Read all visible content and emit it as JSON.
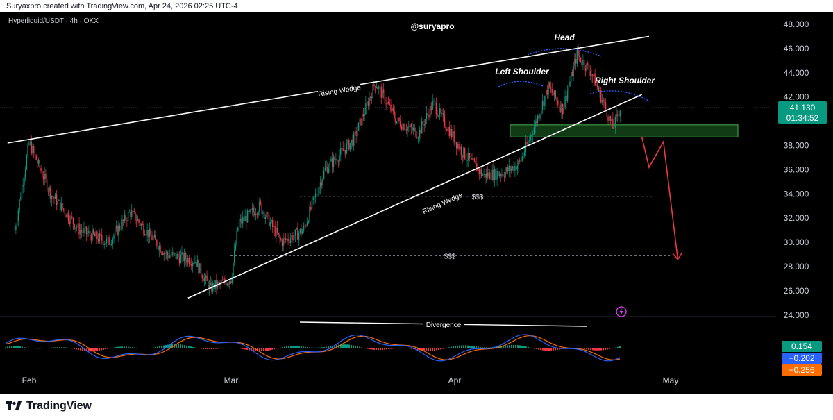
{
  "header": {
    "created_by": "Suryaxpro created with TradingView.com, Apr 24, 2026 02:25 UTC-4"
  },
  "symbol": {
    "label": "Hyperliquid/USDT · 4h · OKX"
  },
  "watermark": "@suryapro",
  "annotations": {
    "head": "Head",
    "left_shoulder": "Left Shoulder",
    "right_shoulder": "Right Shoulder",
    "rising_wedge_upper": "Rising Wedge",
    "rising_wedge_lower": "Rising Wedge",
    "liquidity_1": "$$$",
    "liquidity_2": "$$$",
    "divergence": "Divergence"
  },
  "price_tag": {
    "price": "41.130",
    "countdown": "01:34:52",
    "color": "#089981"
  },
  "indicator_tags": [
    {
      "value": "0.154",
      "color": "#089981"
    },
    {
      "value": "−0.202",
      "color": "#2962ff"
    },
    {
      "value": "−0.256",
      "color": "#ff6d00"
    }
  ],
  "footer": {
    "brand": "TradingView"
  },
  "colors": {
    "candle_up": "#089981",
    "candle_down": "#f23645",
    "wedge_line": "#ffffff",
    "support_zone": "#1e6b24",
    "projection": "#f23645",
    "shoulder_arc": "#2962ff",
    "fast_line": "#2962ff",
    "slow_line": "#ff6d00"
  },
  "chart_data": {
    "type": "candlestick",
    "title": "Hyperliquid/USDT · 4h · OKX",
    "y_axis": {
      "ticks": [
        "48.000",
        "46.000",
        "44.000",
        "42.000",
        "40.000",
        "38.000",
        "36.000",
        "34.000",
        "32.000",
        "30.000",
        "28.000",
        "26.000",
        "24.000"
      ],
      "range": [
        24,
        48
      ]
    },
    "x_axis": {
      "ticks": [
        "Feb",
        "Mar",
        "Apr",
        "May"
      ]
    },
    "price_path": [
      {
        "date": "Jan 30",
        "price": 31
      },
      {
        "date": "Feb 1",
        "price": 38.2
      },
      {
        "date": "Feb 4",
        "price": 34
      },
      {
        "date": "Feb 8",
        "price": 31
      },
      {
        "date": "Feb 12",
        "price": 30
      },
      {
        "date": "Feb 15",
        "price": 32.5
      },
      {
        "date": "Feb 20",
        "price": 29
      },
      {
        "date": "Feb 24",
        "price": 28.5
      },
      {
        "date": "Feb 26",
        "price": 26.2
      },
      {
        "date": "Mar 1",
        "price": 27
      },
      {
        "date": "Mar 2",
        "price": 31.5
      },
      {
        "date": "Mar 5",
        "price": 33
      },
      {
        "date": "Mar 8",
        "price": 30
      },
      {
        "date": "Mar 11",
        "price": 31
      },
      {
        "date": "Mar 14",
        "price": 36
      },
      {
        "date": "Mar 18",
        "price": 38.5
      },
      {
        "date": "Mar 21",
        "price": 43.2
      },
      {
        "date": "Mar 24",
        "price": 40
      },
      {
        "date": "Mar 27",
        "price": 39
      },
      {
        "date": "Mar 29",
        "price": 41.5
      },
      {
        "date": "Apr 2",
        "price": 37.5
      },
      {
        "date": "Apr 5",
        "price": 35.5
      },
      {
        "date": "Apr 8",
        "price": 35.8
      },
      {
        "date": "Apr 10",
        "price": 36.5
      },
      {
        "date": "Apr 12",
        "price": 39.5
      },
      {
        "date": "Apr 14",
        "price": 42.8
      },
      {
        "date": "Apr 16",
        "price": 41
      },
      {
        "date": "Apr 18",
        "price": 45.5
      },
      {
        "date": "Apr 20",
        "price": 44
      },
      {
        "date": "Apr 22",
        "price": 41
      },
      {
        "date": "Apr 23",
        "price": 39.4
      },
      {
        "date": "Apr 24",
        "price": 41.13
      }
    ],
    "support_zone": [
      38.7,
      39.7
    ],
    "liquidity_levels": [
      33.8,
      28.9
    ],
    "projection": [
      {
        "date": "Apr 27",
        "price": 38.7
      },
      {
        "date": "Apr 28",
        "price": 36.2
      },
      {
        "date": "Apr 30",
        "price": 38.3
      },
      {
        "date": "May 2",
        "price": 28.6
      }
    ],
    "wedge_upper": [
      {
        "date": "Jan 29",
        "price": 38.2
      },
      {
        "date": "Apr 28",
        "price": 47.0
      }
    ],
    "wedge_lower": [
      {
        "date": "Feb 23",
        "price": 25.4
      },
      {
        "date": "Apr 27",
        "price": 42.2
      }
    ],
    "oscillator": {
      "readings": {
        "histogram": 0.154,
        "fast": -0.202,
        "slow": -0.256
      }
    },
    "grid": false
  }
}
